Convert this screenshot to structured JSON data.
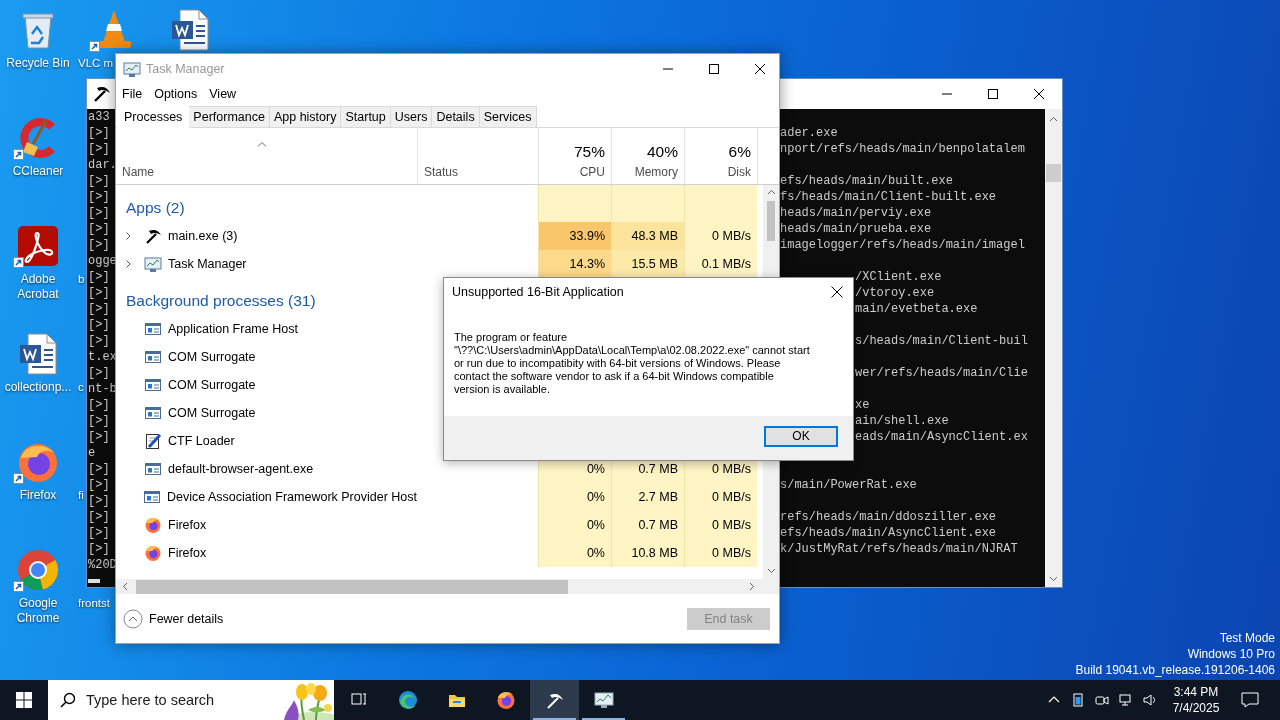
{
  "desktop": {
    "icon_columns": [
      {
        "icons": [
          {
            "label": "Recycle Bin",
            "kind": "recycle-bin",
            "shortcut": false
          },
          {
            "label": "CCleaner",
            "kind": "ccleaner",
            "shortcut": true
          },
          {
            "label": "Adobe Acrobat",
            "kind": "acrobat",
            "shortcut": true
          },
          {
            "label": "collectionp...",
            "kind": "word",
            "shortcut": false
          },
          {
            "label": "Firefox",
            "kind": "firefox",
            "shortcut": true
          },
          {
            "label": "Google Chrome",
            "kind": "chrome",
            "shortcut": true
          }
        ]
      },
      {
        "icons": [
          {
            "label": "VLC m",
            "kind": "vlc",
            "shortcut": true,
            "label_cut": true
          },
          {
            "kind": "covered"
          },
          {
            "label": "b",
            "kind": "covered",
            "label_cut": true
          },
          {
            "label": "c",
            "kind": "covered",
            "label_cut": true
          },
          {
            "label": "fi",
            "kind": "covered",
            "label_cut": true
          },
          {
            "label": "frontst",
            "kind": "covered",
            "label_cut": true
          }
        ]
      },
      {
        "icons": [
          {
            "kind": "word",
            "shortcut": false
          }
        ]
      }
    ],
    "system_info": [
      "Test Mode",
      "Windows 10 Pro",
      "Build 19041.vb_release.191206-1406"
    ]
  },
  "console_window": {
    "lines": [
      {
        "start": "a33"
      },
      {
        "start": "[>]",
        "end": "ader.exe"
      },
      {
        "start": "[>]",
        "end": "nport/refs/heads/main/benpolatalem"
      },
      {
        "start": "dar."
      },
      {
        "start": "[>]",
        "end": "efs/heads/main/built.exe"
      },
      {
        "start": "[>]",
        "end": "fs/heads/main/Client-built.exe"
      },
      {
        "start": "[>]",
        "end": "heads/main/perviy.exe"
      },
      {
        "start": "[>]",
        "end": "heads/main/prueba.exe"
      },
      {
        "start": "[>]",
        "end": "imagelogger/refs/heads/main/imagel"
      },
      {
        "start": "ogge"
      },
      {
        "start": "[>]",
        "end": "/XClient.exe"
      },
      {
        "start": "[>]",
        "end": "/vtoroy.exe"
      },
      {
        "start": "[>]",
        "end": "main/evetbeta.exe"
      },
      {
        "start": "[>]"
      },
      {
        "start": "[>]",
        "end": "s/heads/main/Client-buil"
      },
      {
        "start": "t.ex"
      },
      {
        "start": "[>]",
        "end": "wer/refs/heads/main/Clie"
      },
      {
        "start": "nt-b"
      },
      {
        "start": "[>]",
        "end": "xe"
      },
      {
        "start": "[>]",
        "end": "ain/shell.exe"
      },
      {
        "start": "[>]",
        "end": "eads/main/AsyncClient.ex"
      },
      {
        "start": "e"
      },
      {
        "start": "[>]"
      },
      {
        "start": "[>]",
        "end": "s/main/PowerRat.exe"
      },
      {
        "start": "[>]"
      },
      {
        "start": "[>]",
        "end": "refs/heads/main/ddosziller.exe"
      },
      {
        "start": "[>]",
        "end": "efs/heads/main/AsyncClient.exe"
      },
      {
        "start": "[>]",
        "end": "k/JustMyRat/refs/heads/main/NJRAT"
      },
      {
        "start": "%20D"
      }
    ]
  },
  "task_manager": {
    "title": "Task Manager",
    "active": false,
    "menu": [
      "File",
      "Options",
      "View"
    ],
    "tabs": [
      {
        "label": "Processes",
        "selected": true
      },
      {
        "label": "Performance",
        "selected": false
      },
      {
        "label": "App history",
        "selected": false
      },
      {
        "label": "Startup",
        "selected": false
      },
      {
        "label": "Users",
        "selected": false
      },
      {
        "label": "Details",
        "selected": false
      },
      {
        "label": "Services",
        "selected": false
      }
    ],
    "columns": [
      {
        "label": "Name"
      },
      {
        "label": "Status"
      },
      {
        "total": "75%",
        "label": "CPU"
      },
      {
        "total": "40%",
        "label": "Memory"
      },
      {
        "total": "6%",
        "label": "Disk"
      }
    ],
    "groups": [
      {
        "title": "Apps (2)",
        "processes": [
          {
            "name": "main.exe (3)",
            "kind": "pickaxe",
            "expanded": false,
            "cpu": {
              "text": "33.9%",
              "color": "#f9c66b"
            },
            "memory": {
              "text": "48.3 MB",
              "color": "#fce49c"
            },
            "disk": {
              "text": "0 MB/s",
              "color": "#fff4c4"
            }
          },
          {
            "name": "Task Manager",
            "kind": "task-manager",
            "expanded": false,
            "cpu": {
              "text": "14.3%",
              "color": "#fcd98b"
            },
            "memory": {
              "text": "15.5 MB",
              "color": "#fdeaa9"
            },
            "disk": {
              "text": "0.1 MB/s",
              "color": "#fff4c4"
            }
          }
        ]
      },
      {
        "title": "Background processes (31)",
        "processes": [
          {
            "name": "Application Frame Host",
            "kind": "app-frame"
          },
          {
            "name": "COM Surrogate",
            "kind": "app-frame"
          },
          {
            "name": "COM Surrogate",
            "kind": "app-frame"
          },
          {
            "name": "COM Surrogate",
            "kind": "app-frame"
          },
          {
            "name": "CTF Loader",
            "kind": "ctf"
          },
          {
            "name": "default-browser-agent.exe",
            "kind": "app-frame",
            "cpu": {
              "text": "0%",
              "color": "#fff4c4"
            },
            "memory": {
              "text": "0.7 MB",
              "color": "#fff4c4"
            },
            "disk": {
              "text": "0 MB/s",
              "color": "#fff4c4"
            }
          },
          {
            "name": "Device Association Framework Provider Host",
            "kind": "app-frame",
            "cpu": {
              "text": "0%",
              "color": "#fff4c4"
            },
            "memory": {
              "text": "2.7 MB",
              "color": "#fff4c4"
            },
            "disk": {
              "text": "0 MB/s",
              "color": "#fff4c4"
            }
          },
          {
            "name": "Firefox",
            "kind": "firefox",
            "cpu": {
              "text": "0%",
              "color": "#fff4c4"
            },
            "memory": {
              "text": "0.7 MB",
              "color": "#fff4c4"
            },
            "disk": {
              "text": "0 MB/s",
              "color": "#fff4c4"
            }
          },
          {
            "name": "Firefox",
            "kind": "firefox",
            "cpu": {
              "text": "0%",
              "color": "#fff4c4"
            },
            "memory": {
              "text": "10.8 MB",
              "color": "#fff4c4"
            },
            "disk": {
              "text": "0 MB/s",
              "color": "#fff4c4"
            }
          }
        ]
      }
    ],
    "footer": {
      "fewer_details": "Fewer details",
      "end_task": {
        "label": "End task",
        "disabled": true
      }
    }
  },
  "dialog": {
    "title": "Unsupported 16-Bit Application",
    "message": "The program or feature\n\"\\??\\C:\\Users\\admin\\AppData\\Local\\Temp\\a\\02.08.2022.exe\" cannot start\nor run due to incompatibity with 64-bit versions of Windows. Please\ncontact the software vendor to ask if a 64-bit Windows compatible\nversion is available.",
    "button": "OK"
  },
  "taskbar": {
    "search": {
      "placeholder": "Type here to search"
    },
    "apps": [
      {
        "kind": "task-view",
        "active": false,
        "running": false
      },
      {
        "kind": "edge",
        "active": false,
        "running": false
      },
      {
        "kind": "explorer",
        "active": false,
        "running": false
      },
      {
        "kind": "firefox",
        "active": false,
        "running": false
      },
      {
        "kind": "pickaxe",
        "active": true,
        "running": true
      },
      {
        "kind": "task-manager",
        "active": false,
        "running": true
      }
    ],
    "clock": {
      "time": "3:44 PM",
      "date": "7/4/2025"
    }
  }
}
